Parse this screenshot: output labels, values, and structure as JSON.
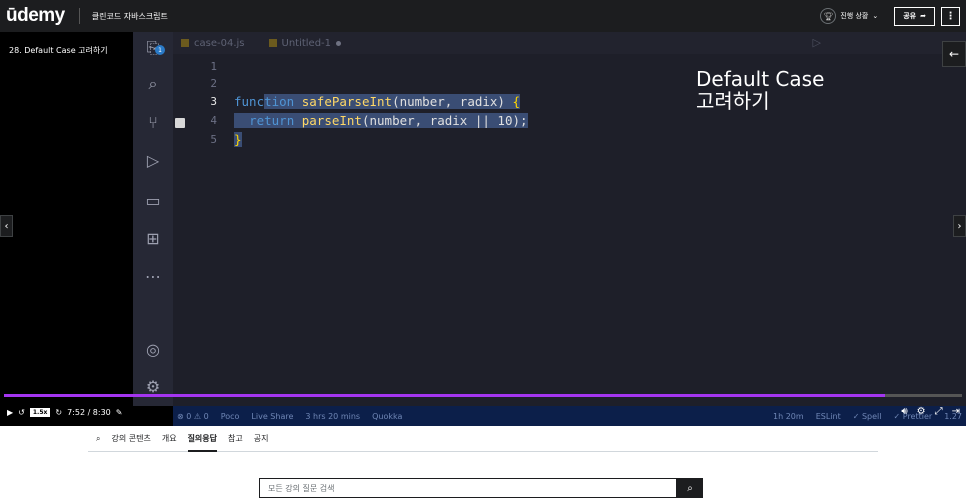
{
  "header": {
    "logo": "ūdemy",
    "course_title": "클린코드 자바스크립트",
    "progress_label": "진행 상황",
    "progress_icon": "trophy-icon",
    "share_label": "공유",
    "more_label": "⋮"
  },
  "video": {
    "lecture_label": "28. Default Case 고려하기",
    "overlay_title_line1": "Default Case",
    "overlay_title_line2": "고려하기",
    "progress_fraction": 0.92
  },
  "editor": {
    "tabs": [
      {
        "label": "case-04.js"
      },
      {
        "label": "Untitled-1"
      }
    ],
    "badge": "1",
    "line_numbers": [
      "1",
      "2",
      "3",
      "4",
      "5"
    ],
    "code_lines": {
      "l3_a": "func",
      "l3_b": "tion",
      "l3_fn": "safeParseInt",
      "l3_params": "(number, radix) ",
      "l3_brace": "{",
      "l4_kw": "return",
      "l4_fn": "parseInt",
      "l4_args": "(number, radix || 10);",
      "l5": "}"
    },
    "status_items_left": [
      "⊗ 0 ⚠ 0",
      "Poco",
      "Live Share",
      "3 hrs 20 mins",
      "Quokka"
    ],
    "status_items_right": [
      "1h 20m",
      "ESLint",
      "✓ Spell",
      "✓ Prettier",
      "1.27"
    ]
  },
  "controls": {
    "speed": "1.5x",
    "time": "7:52 / 8:30"
  },
  "lower_tabs": [
    "강의 콘텐츠",
    "개요",
    "질의응답",
    "참고",
    "공지"
  ],
  "search": {
    "placeholder": "모든 강의 질문 검색"
  }
}
